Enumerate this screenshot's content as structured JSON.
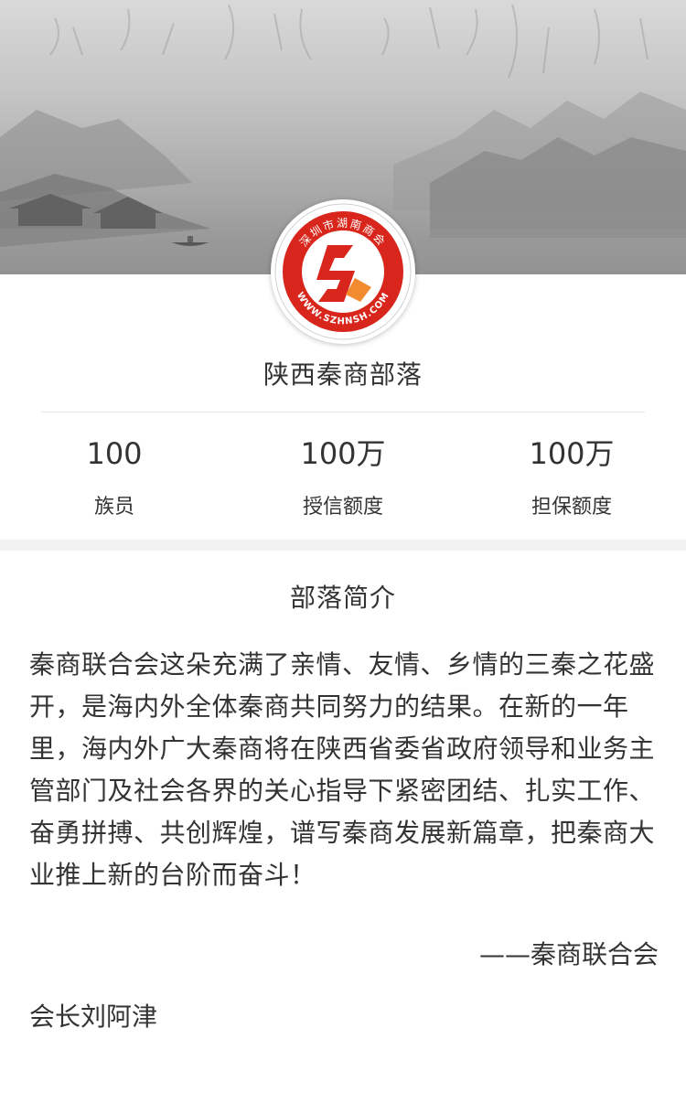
{
  "header": {
    "banner_image": "ink-landscape-painting",
    "logo": {
      "text_top": "深圳市湖南商会",
      "text_bottom": "WWW.SZHNSH.COM",
      "colors": {
        "ring": "#d9261c",
        "accent": "#f28a30"
      }
    }
  },
  "profile": {
    "name": "陕西秦商部落"
  },
  "stats": [
    {
      "value": "100",
      "label": "族员"
    },
    {
      "value": "100万",
      "label": "授信额度"
    },
    {
      "value": "100万",
      "label": "担保额度"
    }
  ],
  "intro": {
    "title": "部落简介",
    "body": "秦商联合会这朵充满了亲情、友情、乡情的三秦之花盛开，是海内外全体秦商共同努力的结果。在新的一年里，海内外广大秦商将在陕西省委省政府领导和业务主管部门及社会各界的关心指导下紧密团结、扎实工作、奋勇拼搏、共创辉煌，谱写秦商发展新篇章，把秦商大业推上新的台阶而奋斗！",
    "signature": "——秦商联合会",
    "president": "会长刘阿津"
  }
}
